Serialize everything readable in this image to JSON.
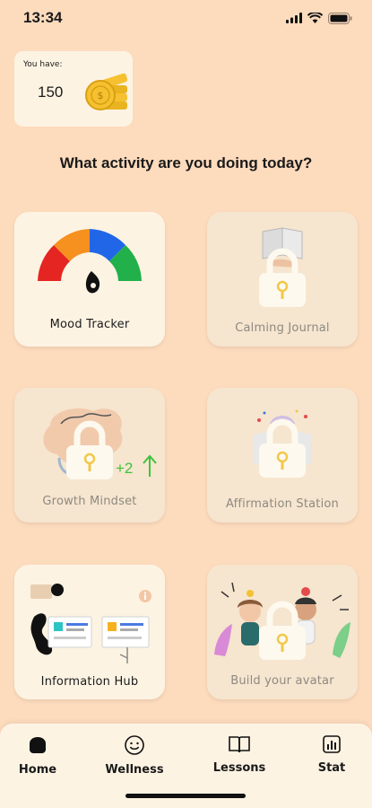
{
  "status": {
    "time": "13:34"
  },
  "wallet": {
    "label": "You have:",
    "amount": "150"
  },
  "headline": "What activity are you doing today?",
  "activities": [
    {
      "label": "Mood Tracker",
      "locked": false
    },
    {
      "label": "Calming Journal",
      "locked": true
    },
    {
      "label": "Growth Mindset",
      "locked": true,
      "badge": "+2"
    },
    {
      "label": "Affirmation Station",
      "locked": true
    },
    {
      "label": "Information Hub",
      "locked": false
    },
    {
      "label": "Build your avatar",
      "locked": true
    }
  ],
  "nav": [
    {
      "label": "Home",
      "icon": "home-icon"
    },
    {
      "label": "Wellness",
      "icon": "smiley-icon"
    },
    {
      "label": "Lessons",
      "icon": "book-icon"
    },
    {
      "label": "Stat",
      "icon": "stats-icon"
    }
  ],
  "colors": {
    "background": "#fddbbd",
    "card": "#fdf3e3",
    "card_locked": "#f6e5cf",
    "gauge_red": "#e52521",
    "gauge_orange": "#f6901e",
    "gauge_blue": "#2266e8",
    "gauge_green": "#22b04b",
    "coin_gold": "#f6c131",
    "arrow_green": "#3cc43c"
  }
}
